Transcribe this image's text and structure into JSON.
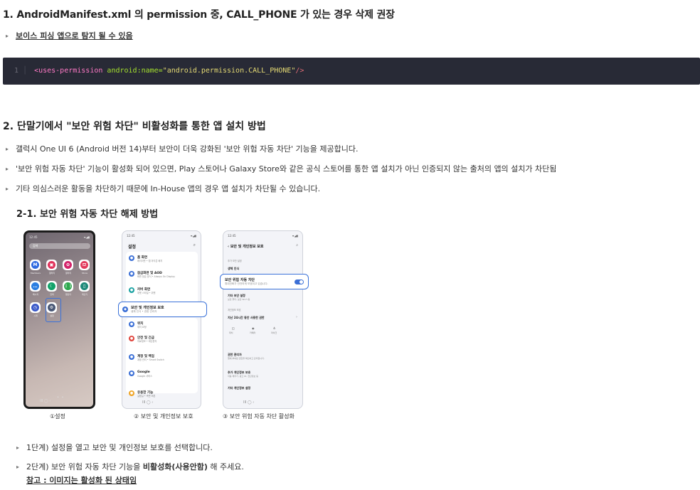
{
  "section1": {
    "title": "1. AndroidManifest.xml 의 permission 중, CALL_PHONE 가 있는 경우 삭제 권장",
    "note": "보이스 피싱 앱으로 탐지 될 수 있음",
    "code": {
      "line_number": "1",
      "tag": "<uses-permission",
      "attr": "android:name=",
      "value": "\"android.permission.CALL_PHONE\"",
      "close": "/>"
    }
  },
  "section2": {
    "title": "2. 단말기에서 \"보안 위험 차단\" 비활성화를 통한 앱 설치 방법",
    "bullets": [
      "갤럭시 One UI 6 (Android 버전 14)부터 보안이 더욱 강화된 '보안 위험 자동 차단' 기능을 제공합니다.",
      "'보안 위험 자동 차단' 기능이 활성화 되어 있으면, Play 스토어나 Galaxy Store와 같은 공식 스토어를 통한 앱 설치가 아닌 인증되지 않는 출처의 앱의 설치가 차단됨",
      "기타 의심스러운 활동을 차단하기 때문에 In-House 앱의 경우 앱 설치가 차단될 수 있습니다."
    ],
    "sub_title": "2-1. 보안 위험 자동 차단 해제 방법",
    "steps": [
      {
        "prefix": "1단계) 설정을 열고 보안 및 개인정보 보호를 선택합니다.",
        "bold": "",
        "suffix": ""
      },
      {
        "prefix": "2단계) 보안 위험 자동 차단 기능을 ",
        "bold": "비활성화(사용안함)",
        "suffix": " 해 주세요."
      }
    ],
    "reference": "참고 : 이미지는 활성화 된 상태임"
  },
  "screens": {
    "captions": [
      "①설정",
      "② 보안 및 개인정보 보호",
      "③ 보안 위험 자동 차단 활성화"
    ],
    "phone1": {
      "time": "12:45",
      "status": "▾ᵢ◢▮",
      "search": "검색",
      "apps": [
        {
          "glyph": "M",
          "label": "Members",
          "color": "#2f6ae0"
        },
        {
          "glyph": "▣",
          "label": "갤러리",
          "color": "#e0315a"
        },
        {
          "glyph": "✿",
          "label": "갤러리",
          "color": "#d4246b"
        },
        {
          "glyph": "⛫",
          "label": "Store",
          "color": "#e23a5c"
        },
        {
          "glyph": "…",
          "label": "메시지",
          "color": "#2a7de1"
        },
        {
          "glyph": "☾",
          "label": "전화",
          "color": "#12a36a"
        },
        {
          "glyph": "⋮⋮",
          "label": "캘린더",
          "color": "#2fa84f"
        },
        {
          "glyph": "▯",
          "label": "계산기",
          "color": "#1e8a7a"
        },
        {
          "glyph": "◷",
          "label": "시계",
          "color": "#3a59c9"
        },
        {
          "glyph": "⚙",
          "label": "설정",
          "color": "#4a5876"
        }
      ],
      "nav": "III    ◯    ‹"
    },
    "phone2": {
      "time": "12:45",
      "title": "설정",
      "rows": [
        {
          "t": "홈 화면",
          "s": "레이아웃 • 앱 아이콘 배지",
          "c": "#3b6fd6"
        },
        {
          "t": "잠금화면 및 AOD",
          "s": "화면 잠금 방식 • Always On Display",
          "c": "#3b6fd6"
        },
        {
          "t": "커버 화면",
          "s": "위젯 스타일 • 위젯",
          "c": "#1ba2a2"
        },
        {
          "t": "보안 및 개인정보 보호",
          "s": "생체 인식 • 권한 관리자",
          "c": "#3b6fd6"
        },
        {
          "t": "위치",
          "s": "위치 요청",
          "c": "#3b6fd6"
        },
        {
          "t": "안전 및 긴급",
          "s": "의료정보 • 재난문자",
          "c": "#e0443c"
        },
        {
          "t": "계정 및 백업",
          "s": "계정 관리 • Smart Switch",
          "c": "#3b6fd6"
        },
        {
          "t": "Google",
          "s": "Google 서비스",
          "c": "#3b6fd6"
        },
        {
          "t": "유용한 기능",
          "s": "실험실 • 측면 버튼",
          "c": "#f0a527"
        }
      ],
      "nav": "III    ◯    ‹"
    },
    "phone3": {
      "time": "12:45",
      "title": "보안 및 개인정보 보호",
      "sec_a": "추가 보안 설정",
      "row_a": "생체 인식",
      "callout_t": "보안 위험 자동 차단",
      "callout_s": "휴대전화가 안전하게 보호되고 있습니다.",
      "row_b": "기타 보안 설정",
      "row_b_s": "보안 폴더, 보안 Wi-Fi 등",
      "sec_b": "개인정보 보호",
      "row_c": "지난 24시간 동안 사용한 권한",
      "perm": [
        "위치",
        "카메라",
        "마이크"
      ],
      "row_d": "권한 관리자",
      "row_d_s": "앱에 부여된 권한을 확인하고 관리합니다.",
      "row_e": "추가 개인정보 보호",
      "row_e_s": "자동 채우기, 광고 ID, 진단정보 등",
      "row_f": "기타 개인정보 설정",
      "nav": "III    ◯    ‹"
    }
  },
  "colors": {
    "accent": "#3b72d9",
    "code_bg": "#282a36"
  }
}
